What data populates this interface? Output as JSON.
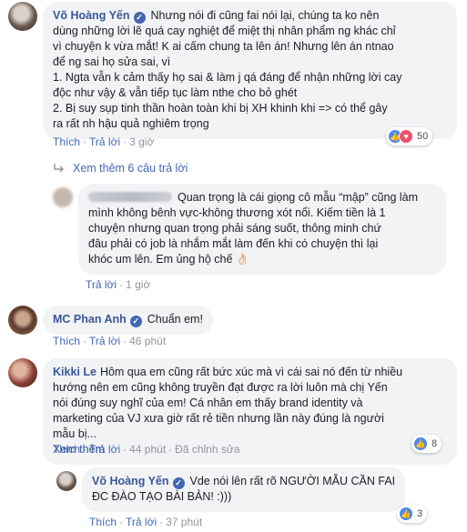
{
  "comments": [
    {
      "author": "Võ Hoàng Yến",
      "verified": true,
      "text_lines": [
        "Nhưng nói đi cũng fai nói lại, chúng ta ko nên",
        "dùng những lời lẽ quá cay nghiệt để miệt thị nhân phẩm ng khác chỉ",
        "vì chuyện k vừa mắt! K ai cấm chung ta lên án! Nhưng lên án ntnao",
        "để ng sai họ sửa sai, vì",
        "1. Ngta vẫn k cảm thấy họ sai & làm j qá đáng để nhận những lời cay",
        "độc như vậy & vẫn tiếp tục làm nthe cho bỏ ghét",
        "2. Bị suy sụp tinh thần hoàn toàn khi bị XH khinh khi => có thể gây",
        "ra rất nh hậu quả nghiêm trọng"
      ],
      "like": "Thích",
      "reply": "Trả lời",
      "time": "3 giờ",
      "reaction_count": "50"
    },
    {
      "author": "",
      "text_lines": [
        "Quan trọng là cái giọng cô mẫu “mập” cũng làm",
        "mình không bênh vực-không thương xót nổi. Kiếm tiền là 1",
        "chuyện nhưng quan trọng phải sáng suốt, thông minh chứ",
        "đâu phải có job là nhắm mắt làm đến khi có chuyện thì lại",
        "khóc um lên. Em ủng hộ chế 👌🏻"
      ],
      "reply": "Trả lời",
      "time": "1 giờ"
    },
    {
      "author": "MC Phan Anh",
      "verified": true,
      "text": "Chuẩn em!",
      "like": "Thích",
      "reply": "Trả lời",
      "time": "46 phút"
    },
    {
      "author": "Kikki Le",
      "text_first": "Hôm qua em cũng rất bức xúc mà vì cái sai nó đến từ nhiều",
      "text_lines": [
        "hướng nên em cũng không truyền đạt được ra lời luôn mà chị Yến",
        "nói đúng suy nghĩ của em! Cá nhân em thấy brand identity và",
        "marketing của VJ xưa giờ rất rẻ tiền nhưng lần này đúng là người",
        "mẫu bị..."
      ],
      "see_more": "Xem thêm",
      "like": "Thích",
      "reply": "Trả lời",
      "time": "44 phút",
      "edited": "Đã chỉnh sửa",
      "reaction_count": "8"
    },
    {
      "author": "Võ Hoàng Yến",
      "verified": true,
      "text_first": "Vde nói lên rất rõ NGƯỜI MẪU CẦN FAI",
      "text_lines": [
        "ĐC ĐÀO TẠO BÀI BẢN! :)))"
      ],
      "like": "Thích",
      "reply": "Trả lời",
      "time": "37 phút",
      "reaction_count": "3"
    }
  ],
  "see_more_replies": "Xem thêm 6 câu trả lời",
  "dot": "·",
  "icons": [
    "verified-badge-icon",
    "like-reaction-icon",
    "love-reaction-icon",
    "reply-arrow-icon"
  ],
  "colors": {
    "link": "#385898",
    "bubble": "#f2f3f5",
    "meta": "#90949c",
    "like": "#4a89f3",
    "love": "#f0516a"
  }
}
